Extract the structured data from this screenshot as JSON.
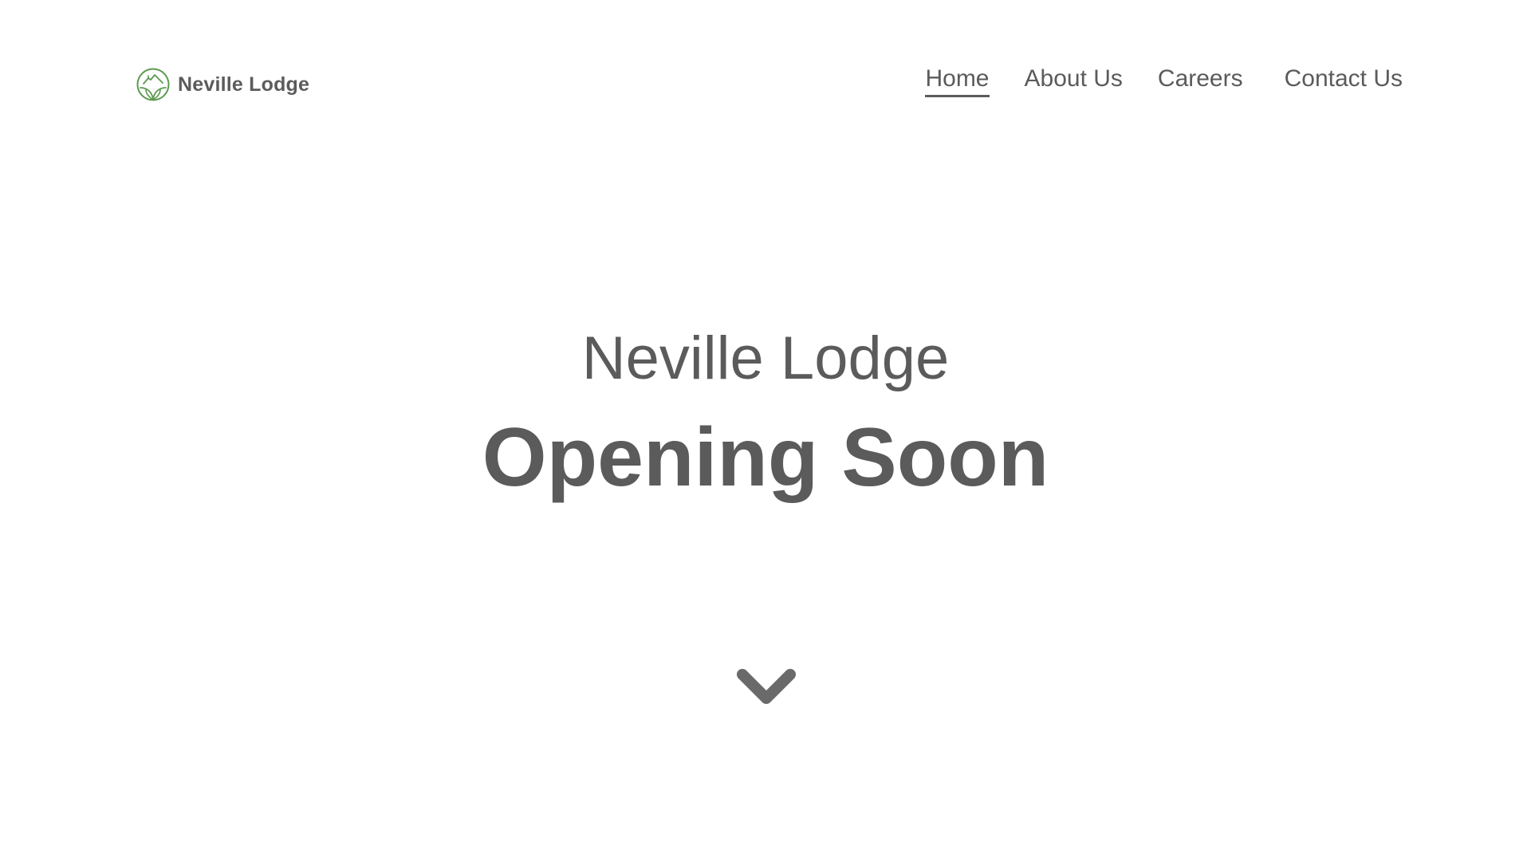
{
  "header": {
    "logo_text": "Neville Lodge",
    "logo_icon": "leaf-house-emblem-icon",
    "logo_color": "#5b9a4f",
    "nav": [
      {
        "label": "Home",
        "active": true
      },
      {
        "label": "About Us",
        "active": false
      },
      {
        "label": "Careers",
        "active": false
      },
      {
        "label": "Contact Us",
        "active": false
      }
    ]
  },
  "hero": {
    "subtitle": "Neville Lodge",
    "title": "Opening Soon",
    "scroll_icon": "chevron-down-icon"
  },
  "colors": {
    "text": "#5b5b5b",
    "background": "#ffffff",
    "accent": "#5b9a4f"
  }
}
